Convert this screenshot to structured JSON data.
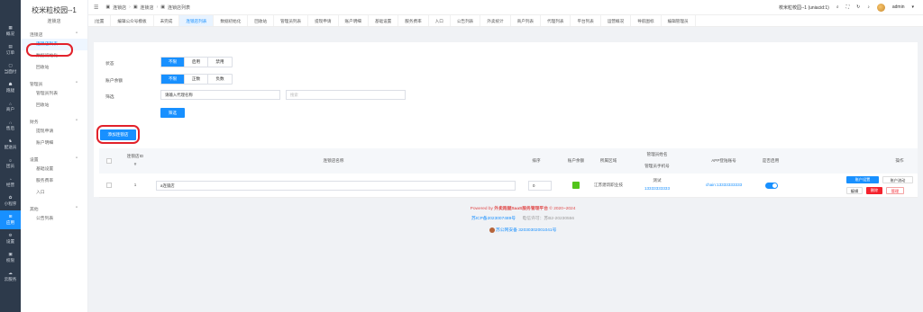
{
  "rail": [
    {
      "label": "概况",
      "icon": "grid-icon"
    },
    {
      "label": "订单",
      "icon": "order-icon"
    },
    {
      "label": "当面付",
      "icon": "pay-icon"
    },
    {
      "label": "跑腿",
      "icon": "run-icon"
    },
    {
      "label": "商户",
      "icon": "shop-icon"
    },
    {
      "label": "售后",
      "icon": "headset-icon"
    },
    {
      "label": "配送员",
      "icon": "rider-icon"
    },
    {
      "label": "团员",
      "icon": "team-icon"
    },
    {
      "label": "经营",
      "icon": "chart-icon"
    },
    {
      "label": "小程序",
      "icon": "app-icon"
    },
    {
      "label": "应用",
      "icon": "apps-icon"
    },
    {
      "label": "设置",
      "icon": "gear-icon"
    },
    {
      "label": "权限",
      "icon": "lock-icon"
    },
    {
      "label": "云服务",
      "icon": "cloud-icon"
    }
  ],
  "side": {
    "title": "校米粒校园--1",
    "subtitle": "连锁店",
    "groups": [
      {
        "label": "连锁店",
        "items": [
          "连锁店列表",
          "数据初始化",
          "回收站"
        ]
      },
      {
        "label": "管理员",
        "items": [
          "管理员列表",
          "回收站"
        ]
      },
      {
        "label": "财务",
        "items": [
          "提现申请",
          "账户明细"
        ]
      },
      {
        "label": "设置",
        "items": [
          "基础设置",
          "服务费率",
          "入口"
        ]
      },
      {
        "label": "其他",
        "items": [
          "公告列表"
        ]
      }
    ]
  },
  "topbar": {
    "crumb": [
      "连锁店",
      "连锁店",
      "连锁店列表"
    ],
    "school": "校米粒校园--1 (uniacid:1)",
    "user": "admin"
  },
  "tabs": [
    "|位置",
    "编辑公众号模板",
    "未完成",
    "连锁店列表",
    "数据初始化",
    "回收站",
    "管理员列表",
    "提现申请",
    "账户明细",
    "基础设置",
    "服务费率",
    "入口",
    "公告列表",
    "外卖统计",
    "商户列表",
    "代理列表",
    "平台列表",
    "运营概况",
    "导航图标",
    "编辑管理员"
  ],
  "filter": {
    "status_label": "状态",
    "status_options": [
      "不限",
      "启用",
      "禁用"
    ],
    "balance_label": "账户余额",
    "balance_options": [
      "不限",
      "正数",
      "负数"
    ],
    "search_label": "筛选",
    "search_placeholder": "请输入代理名称",
    "search_placeholder2": "搜索",
    "search_button": "筛选"
  },
  "add_button": "添加连锁店",
  "table": {
    "headers": [
      "连锁店ID",
      "连锁店名称",
      "排序",
      "账户余额",
      "所属区域",
      "管理员姓名",
      "管理员手机号",
      "APP登陆账号",
      "是否启用",
      "操作"
    ],
    "id_sub": "#",
    "row": {
      "id": "1",
      "name": "a连锁店",
      "sort": "0",
      "region": "江苏建筑职业技",
      "admin_name": "测试",
      "admin_phone": "13333333333",
      "app_account": "chain:13333333333",
      "actions": [
        "账户设置",
        "账户流动",
        "编辑",
        "删除",
        "管理"
      ]
    }
  },
  "footer": {
    "line1_prefix": "Powered by ",
    "line1_brand": "外卖跑腿SaaS服务管理平台",
    "line1_suffix": " © 2020~2024",
    "icp": "苏ICP备2023007489号",
    "telecom": "电信许可：苏B2-20230556",
    "police": "苏公网安备 32030302001041号"
  },
  "colors": {
    "primary": "#1890ff",
    "danger": "#f5222d",
    "rail": "#2d3a4b",
    "highlight": "#e2212a"
  }
}
